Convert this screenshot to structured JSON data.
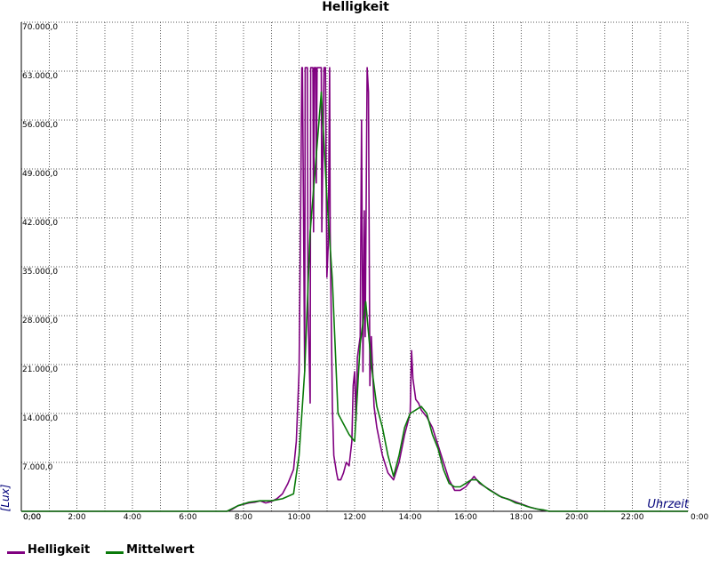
{
  "chart_data": {
    "type": "line",
    "title": "Helligkeit",
    "xlabel": "Uhrzeit",
    "ylabel": "[Lux]",
    "xlim": [
      0,
      24
    ],
    "ylim": [
      0,
      70000
    ],
    "grid": true,
    "legend_placement": "bottom-left",
    "x_tick_labels": [
      "0:00",
      "2:00",
      "4:00",
      "6:00",
      "8:00",
      "10:00",
      "12:00",
      "14:00",
      "16:00",
      "18:00",
      "20:00",
      "22:00",
      "0:00"
    ],
    "y_tick_labels": [
      "0,00",
      "7.000,0",
      "14.000,0",
      "21.000,0",
      "28.000,0",
      "35.000,0",
      "42.000,0",
      "49.000,0",
      "56.000,0",
      "63.000,0",
      "70.000,0"
    ],
    "series": [
      {
        "name": "Helligkeit",
        "color": "#800080",
        "x": [
          0,
          7.4,
          7.6,
          7.8,
          8.0,
          8.2,
          8.4,
          8.6,
          8.8,
          9.0,
          9.2,
          9.4,
          9.6,
          9.8,
          9.9,
          10.0,
          10.05,
          10.1,
          10.12,
          10.2,
          10.22,
          10.3,
          10.32,
          10.4,
          10.42,
          10.5,
          10.52,
          10.55,
          10.6,
          10.62,
          10.65,
          10.7,
          10.72,
          10.75,
          10.8,
          10.82,
          10.9,
          10.95,
          11.0,
          11.05,
          11.1,
          11.12,
          11.2,
          11.25,
          11.35,
          11.4,
          11.5,
          11.6,
          11.7,
          11.8,
          11.9,
          11.95,
          12.0,
          12.05,
          12.1,
          12.2,
          12.25,
          12.3,
          12.35,
          12.38,
          12.4,
          12.45,
          12.5,
          12.55,
          12.6,
          12.7,
          12.8,
          12.9,
          13.0,
          13.2,
          13.4,
          13.6,
          13.8,
          14.0,
          14.05,
          14.1,
          14.15,
          14.2,
          14.3,
          14.4,
          14.6,
          14.8,
          15.0,
          15.2,
          15.4,
          15.6,
          15.8,
          16.0,
          16.2,
          16.3,
          16.5,
          16.7,
          16.9,
          17.1,
          17.3,
          17.5,
          17.7,
          17.9,
          18.1,
          18.3,
          18.5,
          18.7,
          19.0,
          20,
          22,
          24
        ],
        "values": [
          0,
          0,
          300,
          800,
          1000,
          1200,
          1300,
          1500,
          1200,
          1400,
          1800,
          2500,
          4000,
          6000,
          10000,
          20000,
          40000,
          63500,
          63500,
          20000,
          63500,
          63500,
          30000,
          15500,
          63500,
          63500,
          40000,
          63500,
          63500,
          47000,
          63500,
          63500,
          63500,
          63500,
          63500,
          40000,
          63500,
          63500,
          33500,
          38000,
          63500,
          40000,
          15000,
          8000,
          5500,
          4500,
          4500,
          5500,
          7000,
          6500,
          10000,
          18000,
          20000,
          13000,
          22000,
          25000,
          56000,
          20000,
          43000,
          25000,
          35000,
          63500,
          60000,
          18000,
          25000,
          15000,
          12000,
          10000,
          8000,
          5500,
          4500,
          7000,
          11000,
          14000,
          23000,
          19000,
          17500,
          16000,
          15500,
          14500,
          13500,
          12000,
          9500,
          7000,
          4500,
          3000,
          3000,
          3500,
          4500,
          5000,
          4000,
          3500,
          3000,
          2500,
          2000,
          1800,
          1500,
          1200,
          900,
          600,
          400,
          200,
          0,
          0,
          0,
          0
        ]
      },
      {
        "name": "Mittelwert",
        "color": "#0a7a0a",
        "x": [
          0,
          7.4,
          7.8,
          8.2,
          8.6,
          9.0,
          9.4,
          9.8,
          10.0,
          10.2,
          10.4,
          10.6,
          10.8,
          11.0,
          11.2,
          11.4,
          11.6,
          11.8,
          12.0,
          12.2,
          12.4,
          12.6,
          12.8,
          13.0,
          13.2,
          13.4,
          13.6,
          13.8,
          14.0,
          14.2,
          14.4,
          14.6,
          14.8,
          15.0,
          15.2,
          15.4,
          15.6,
          15.8,
          16.0,
          16.2,
          16.4,
          16.6,
          16.8,
          17.0,
          17.2,
          17.4,
          17.6,
          17.8,
          18.0,
          18.2,
          18.4,
          18.6,
          18.8,
          19.0,
          20,
          22,
          24
        ],
        "values": [
          0,
          0,
          800,
          1300,
          1500,
          1500,
          1800,
          2500,
          8000,
          20000,
          40000,
          50000,
          60000,
          45000,
          33000,
          14000,
          12500,
          11000,
          10000,
          24000,
          30000,
          21000,
          15000,
          12000,
          8000,
          5000,
          8000,
          12000,
          14000,
          14500,
          15000,
          14000,
          11000,
          9000,
          6000,
          4000,
          3500,
          3500,
          4000,
          4500,
          4500,
          3800,
          3200,
          2700,
          2200,
          1900,
          1600,
          1200,
          1000,
          700,
          500,
          300,
          200,
          0,
          0,
          0,
          0
        ]
      }
    ]
  }
}
